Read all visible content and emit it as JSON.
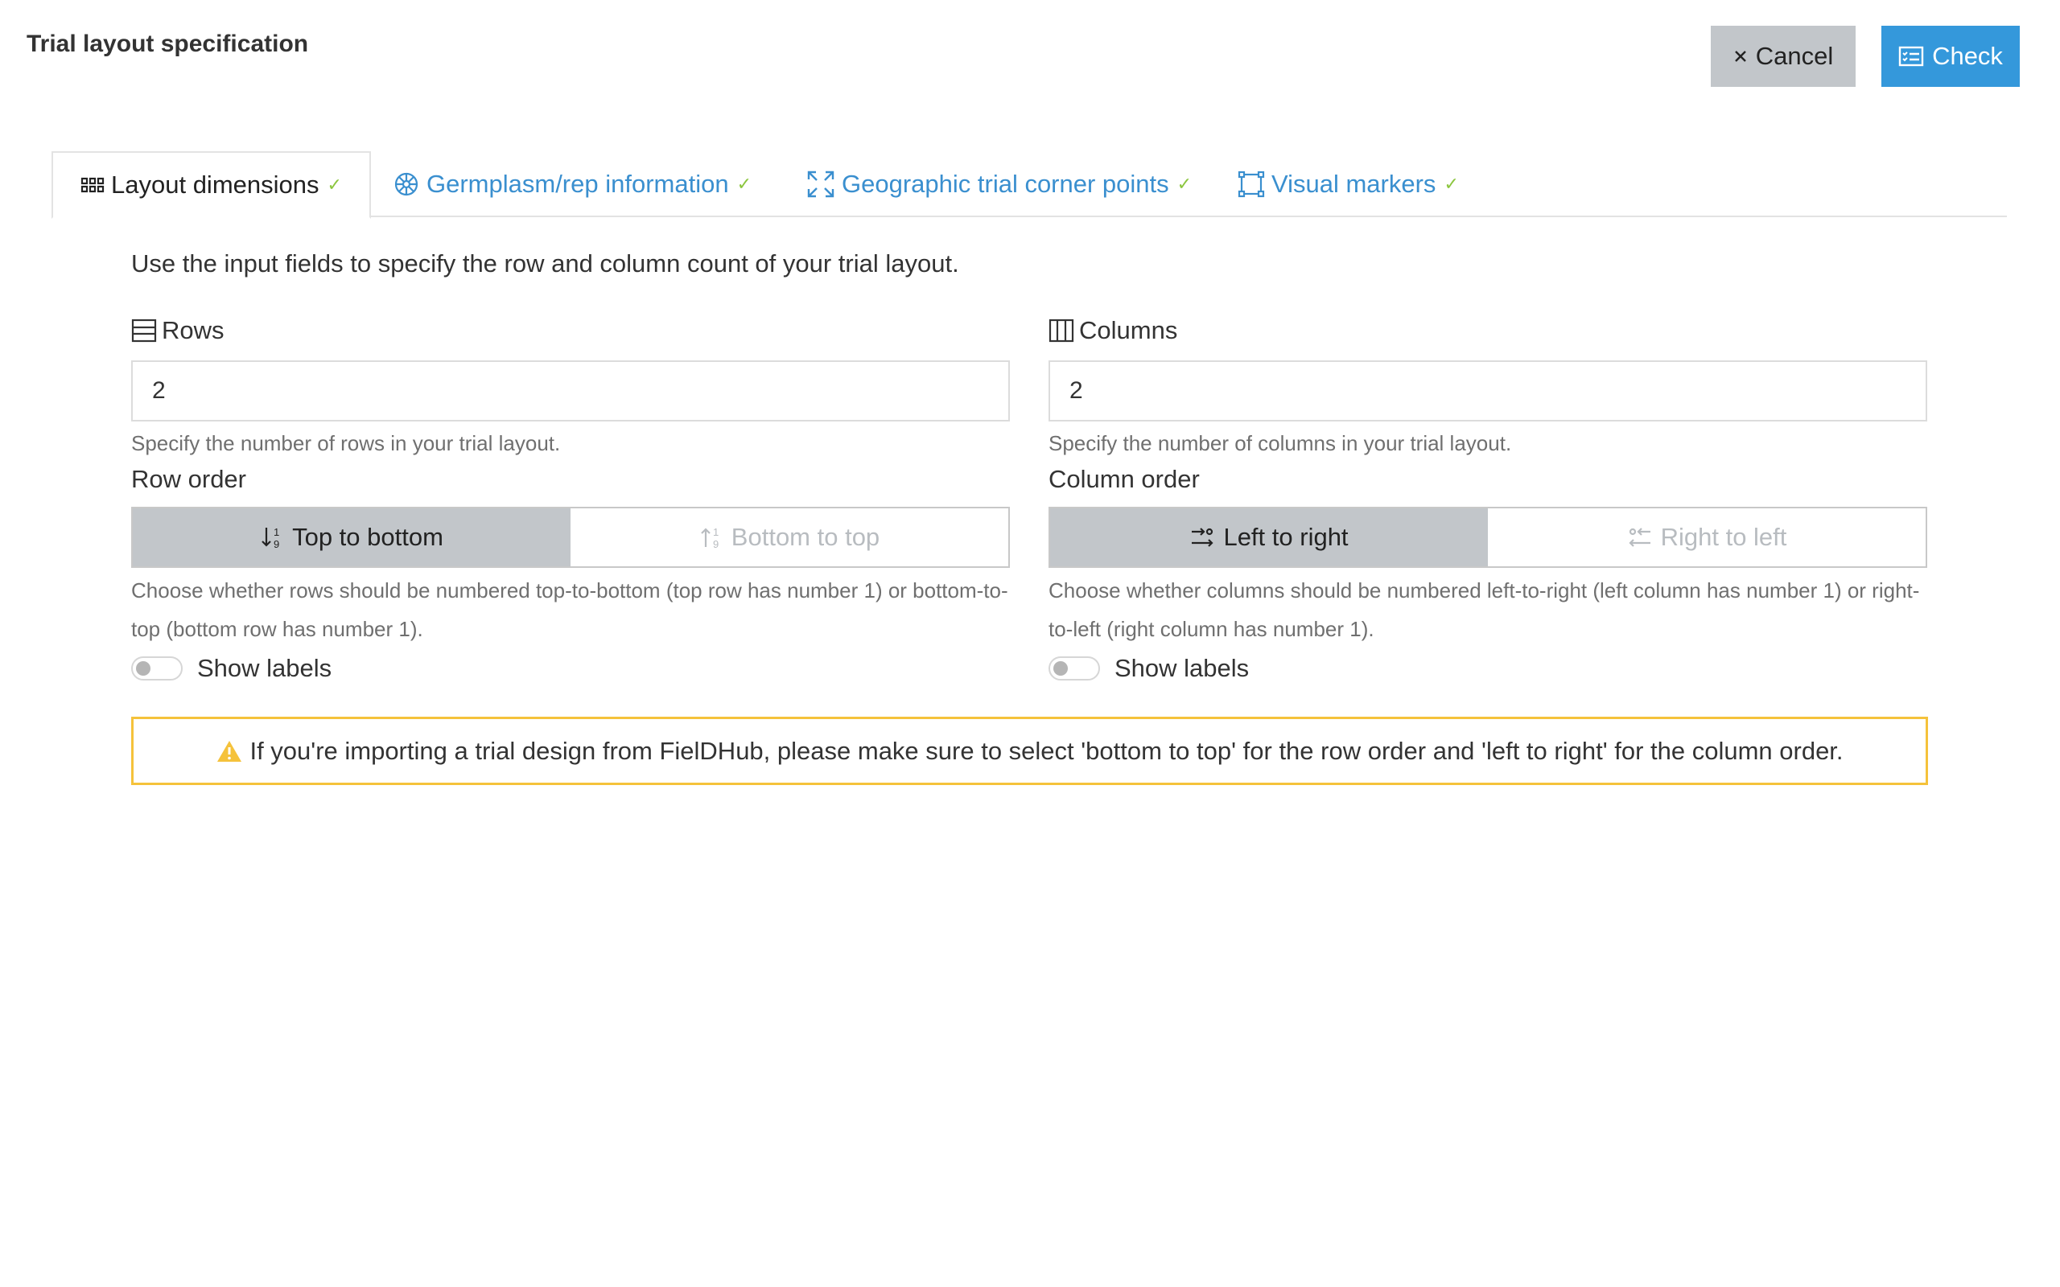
{
  "header": {
    "title": "Trial layout specification",
    "cancel_label": "Cancel",
    "check_label": "Check"
  },
  "tabs": [
    {
      "label": "Layout dimensions",
      "icon": "grid-icon",
      "active": true
    },
    {
      "label": "Germplasm/rep information",
      "icon": "flower-icon",
      "active": false
    },
    {
      "label": "Geographic trial corner points",
      "icon": "expand-corners-icon",
      "active": false
    },
    {
      "label": "Visual markers",
      "icon": "bounding-box-icon",
      "active": false
    }
  ],
  "intro": "Use the input fields to specify the row and column count of your trial layout.",
  "rows": {
    "label": "Rows",
    "value": "2",
    "help": "Specify the number of rows in your trial layout.",
    "order_label": "Row order",
    "options": [
      "Top to bottom",
      "Bottom to top"
    ],
    "selected": "Top to bottom",
    "order_help": "Choose whether rows should be numbered top-to-bottom (top row has number 1) or bottom-to-top (bottom row has number 1).",
    "show_labels": "Show labels"
  },
  "columns": {
    "label": "Columns",
    "value": "2",
    "help": "Specify the number of columns in your trial layout.",
    "order_label": "Column order",
    "options": [
      "Left to right",
      "Right to left"
    ],
    "selected": "Left to right",
    "order_help": "Choose whether columns should be numbered left-to-right (left column has number 1) or right-to-left (right column has number 1).",
    "show_labels": "Show labels"
  },
  "alert": "If you're importing a trial design from FielDHub, please make sure to select 'bottom to top' for the row order and 'left to right' for the column order.",
  "colors": {
    "primary": "#3498db",
    "secondary": "#c2c6ca",
    "tab_link": "#3a8fcf",
    "check_mark": "#8cc63f",
    "warning": "#f5c23b"
  }
}
